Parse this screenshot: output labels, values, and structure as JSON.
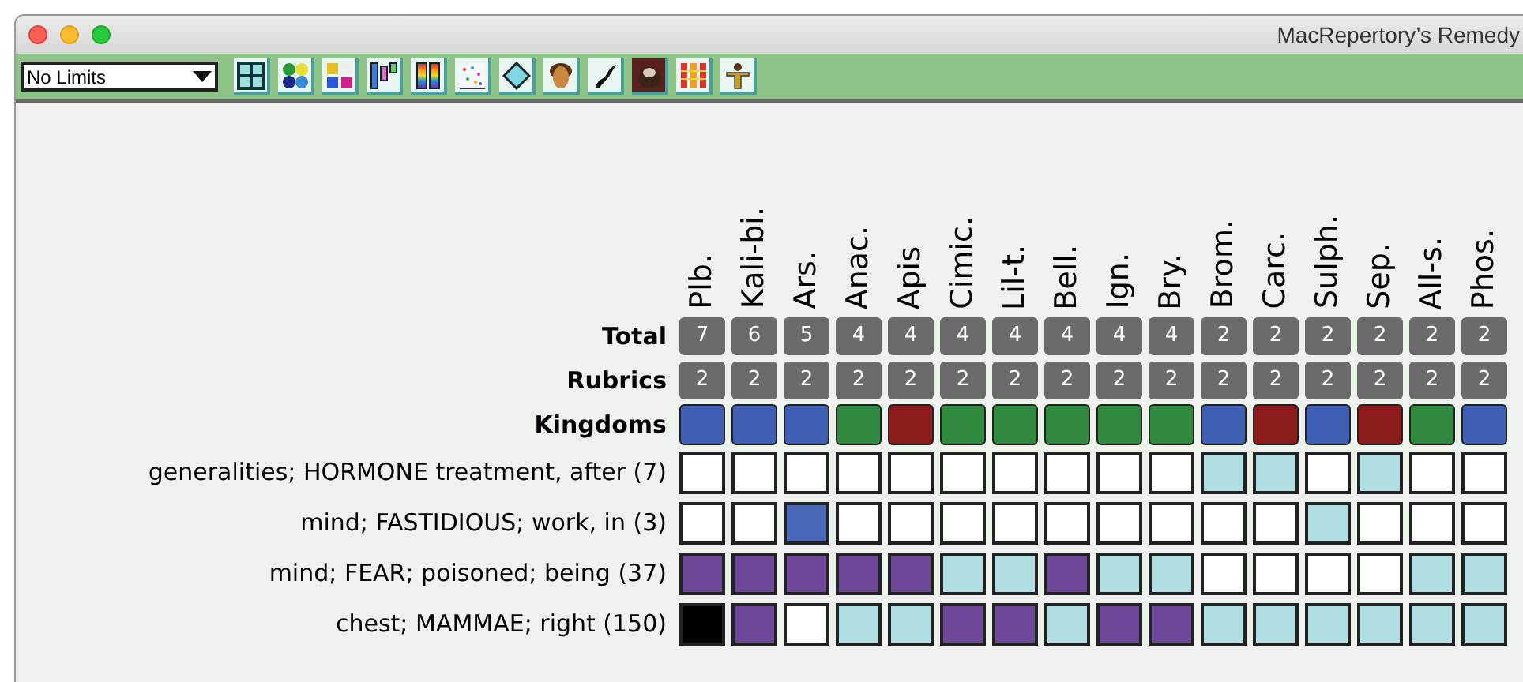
{
  "window": {
    "title": "MacRepertory’s Remedy"
  },
  "toolbar": {
    "limit_select": {
      "value": "No Limits"
    },
    "tools": [
      {
        "kind": "grid",
        "selected": false
      },
      {
        "kind": "dots",
        "selected": false
      },
      {
        "kind": "numbers",
        "selected": false
      },
      {
        "kind": "bars",
        "selected": false
      },
      {
        "kind": "rainbow",
        "selected": false
      },
      {
        "kind": "scatter",
        "selected": false
      },
      {
        "kind": "diamond",
        "selected": false
      },
      {
        "kind": "face",
        "selected": false
      },
      {
        "kind": "animal",
        "selected": false
      },
      {
        "kind": "head",
        "selected": true
      },
      {
        "kind": "columns",
        "selected": false
      },
      {
        "kind": "figure",
        "selected": false
      }
    ]
  },
  "row_labels": {
    "total": "Total",
    "rubrics": "Rubrics",
    "kingdoms": "Kingdoms"
  },
  "remedies": [
    {
      "name": "Plb.",
      "total": "7",
      "rubrics": "2",
      "color": "#3f5fb5"
    },
    {
      "name": "Kali-bi.",
      "total": "6",
      "rubrics": "2",
      "color": "#3f5fb5"
    },
    {
      "name": "Ars.",
      "total": "5",
      "rubrics": "2",
      "color": "#3f5fb5"
    },
    {
      "name": "Anac.",
      "total": "4",
      "rubrics": "2",
      "color": "#2f8a3f"
    },
    {
      "name": "Apis",
      "total": "4",
      "rubrics": "2",
      "color": "#8e1b1b"
    },
    {
      "name": "Cimic.",
      "total": "4",
      "rubrics": "2",
      "color": "#2f8a3f"
    },
    {
      "name": "Lil-t.",
      "total": "4",
      "rubrics": "2",
      "color": "#2f8a3f"
    },
    {
      "name": "Bell.",
      "total": "4",
      "rubrics": "2",
      "color": "#2f8a3f"
    },
    {
      "name": "Ign.",
      "total": "4",
      "rubrics": "2",
      "color": "#2f8a3f"
    },
    {
      "name": "Bry.",
      "total": "4",
      "rubrics": "2",
      "color": "#2f8a3f"
    },
    {
      "name": "Brom.",
      "total": "2",
      "rubrics": "2",
      "color": "#3f5fb5"
    },
    {
      "name": "Carc.",
      "total": "2",
      "rubrics": "2",
      "color": "#8e1b1b"
    },
    {
      "name": "Sulph.",
      "total": "2",
      "rubrics": "2",
      "color": "#3f5fb5"
    },
    {
      "name": "Sep.",
      "total": "2",
      "rubrics": "2",
      "color": "#8e1b1b"
    },
    {
      "name": "All-s.",
      "total": "2",
      "rubrics": "2",
      "color": "#2f8a3f"
    },
    {
      "name": "Phos.",
      "total": "2",
      "rubrics": "2",
      "color": "#3f5fb5"
    }
  ],
  "rubrics": [
    {
      "label": "generalities; HORMONE treatment, after (7)",
      "cells": [
        {
          "color": "#ffffff"
        },
        {
          "color": "#ffffff"
        },
        {
          "color": "#ffffff"
        },
        {
          "color": "#ffffff"
        },
        {
          "color": "#ffffff"
        },
        {
          "color": "#ffffff"
        },
        {
          "color": "#ffffff"
        },
        {
          "color": "#ffffff"
        },
        {
          "color": "#ffffff"
        },
        {
          "color": "#ffffff"
        },
        {
          "color": "#b0dfe3"
        },
        {
          "color": "#b0dfe3"
        },
        {
          "color": "#ffffff"
        },
        {
          "color": "#b0dfe3"
        },
        {
          "color": "#ffffff"
        },
        {
          "color": "#ffffff"
        }
      ]
    },
    {
      "label": "mind; FASTIDIOUS; work, in (3)",
      "cells": [
        {
          "color": "#ffffff"
        },
        {
          "color": "#ffffff"
        },
        {
          "color": "#4a68b8"
        },
        {
          "color": "#ffffff"
        },
        {
          "color": "#ffffff"
        },
        {
          "color": "#ffffff"
        },
        {
          "color": "#ffffff"
        },
        {
          "color": "#ffffff"
        },
        {
          "color": "#ffffff"
        },
        {
          "color": "#ffffff"
        },
        {
          "color": "#ffffff"
        },
        {
          "color": "#ffffff"
        },
        {
          "color": "#b0dfe3"
        },
        {
          "color": "#ffffff"
        },
        {
          "color": "#ffffff"
        },
        {
          "color": "#ffffff"
        }
      ]
    },
    {
      "label": "mind; FEAR; poisoned; being (37)",
      "cells": [
        {
          "color": "#6e4799"
        },
        {
          "color": "#6e4799"
        },
        {
          "color": "#6e4799"
        },
        {
          "color": "#6e4799"
        },
        {
          "color": "#6e4799"
        },
        {
          "color": "#b0dfe3"
        },
        {
          "color": "#b0dfe3"
        },
        {
          "color": "#6e4799"
        },
        {
          "color": "#b0dfe3"
        },
        {
          "color": "#b0dfe3"
        },
        {
          "color": "#ffffff"
        },
        {
          "color": "#ffffff"
        },
        {
          "color": "#ffffff"
        },
        {
          "color": "#ffffff"
        },
        {
          "color": "#b0dfe3"
        },
        {
          "color": "#b0dfe3"
        }
      ]
    },
    {
      "label": "chest; MAMMAE; right (150)",
      "cells": [
        {
          "color": "#000000"
        },
        {
          "color": "#6e4799"
        },
        {
          "color": "#ffffff"
        },
        {
          "color": "#b0dfe3"
        },
        {
          "color": "#b0dfe3"
        },
        {
          "color": "#6e4799"
        },
        {
          "color": "#6e4799"
        },
        {
          "color": "#b0dfe3"
        },
        {
          "color": "#6e4799"
        },
        {
          "color": "#6e4799"
        },
        {
          "color": "#b0dfe3"
        },
        {
          "color": "#b0dfe3"
        },
        {
          "color": "#b0dfe3"
        },
        {
          "color": "#b0dfe3"
        },
        {
          "color": "#b0dfe3"
        },
        {
          "color": "#b0dfe3"
        }
      ]
    }
  ]
}
